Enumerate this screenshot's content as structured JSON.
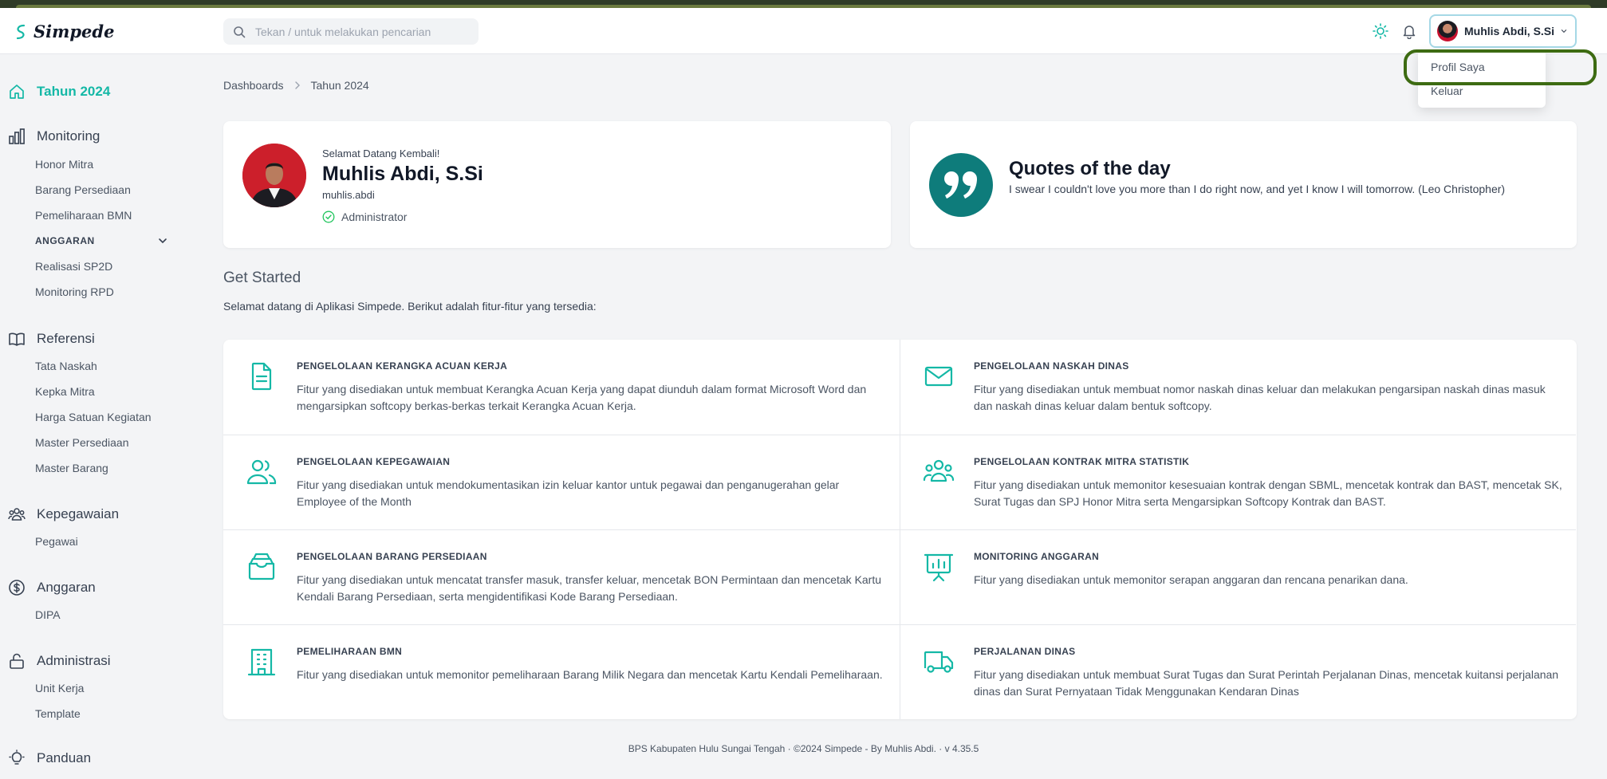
{
  "app": {
    "name": "Simpede"
  },
  "search": {
    "placeholder": "Tekan / untuk melakukan pencarian"
  },
  "user": {
    "name": "Muhlis Abdi, S.Si",
    "username": "muhlis.abdi",
    "role": "Administrator"
  },
  "user_menu": {
    "items": [
      "Profil Saya",
      "Keluar"
    ]
  },
  "sidebar": {
    "home": "Tahun 2024",
    "monitoring": {
      "label": "Monitoring",
      "items": [
        "Honor Mitra",
        "Barang Persediaan",
        "Pemeliharaan BMN"
      ],
      "section": "ANGGARAN",
      "section_items": [
        "Realisasi SP2D",
        "Monitoring RPD"
      ]
    },
    "referensi": {
      "label": "Referensi",
      "items": [
        "Tata Naskah",
        "Kepka Mitra",
        "Harga Satuan Kegiatan",
        "Master Persediaan",
        "Master Barang"
      ]
    },
    "kepegawaian": {
      "label": "Kepegawaian",
      "items": [
        "Pegawai"
      ]
    },
    "anggaran": {
      "label": "Anggaran",
      "items": [
        "DIPA"
      ]
    },
    "administrasi": {
      "label": "Administrasi",
      "items": [
        "Unit Kerja",
        "Template"
      ]
    },
    "panduan": {
      "label": "Panduan"
    }
  },
  "breadcrumb": [
    "Dashboards",
    "Tahun 2024"
  ],
  "welcome": {
    "greeting": "Selamat Datang Kembali!"
  },
  "quote": {
    "title": "Quotes of the day",
    "text": "I swear I couldn't love you more than I do right now, and yet I know I will tomorrow. (Leo Christopher)"
  },
  "get_started": {
    "title": "Get Started",
    "description": "Selamat datang di Aplikasi Simpede. Berikut adalah fitur-fitur yang tersedia:"
  },
  "features": [
    {
      "title": "PENGELOLAAN KERANGKA ACUAN KERJA",
      "desc": "Fitur yang disediakan untuk membuat Kerangka Acuan Kerja yang dapat diunduh dalam format Microsoft Word dan mengarsipkan softcopy berkas-berkas terkait Kerangka Acuan Kerja.",
      "icon": "document-icon"
    },
    {
      "title": "PENGELOLAAN NASKAH DINAS",
      "desc": "Fitur yang disediakan untuk membuat nomor naskah dinas keluar dan melakukan pengarsipan naskah dinas masuk dan naskah dinas keluar dalam bentuk softcopy.",
      "icon": "mail-icon"
    },
    {
      "title": "PENGELOLAAN KEPEGAWAIAN",
      "desc": "Fitur yang disediakan untuk mendokumentasikan izin keluar kantor untuk pegawai dan penganugerahan gelar Employee of the Month",
      "icon": "users-icon"
    },
    {
      "title": "PENGELOLAAN KONTRAK MITRA STATISTIK",
      "desc": "Fitur yang disediakan untuk memonitor kesesuaian kontrak dengan SBML, mencetak kontrak dan BAST, mencetak SK, Surat Tugas dan SPJ Honor Mitra serta Mengarsipkan Softcopy Kontrak dan BAST.",
      "icon": "user-group-icon"
    },
    {
      "title": "PENGELOLAAN BARANG PERSEDIAAN",
      "desc": "Fitur yang disediakan untuk mencatat transfer masuk, transfer keluar, mencetak BON Permintaan dan mencetak Kartu Kendali Barang Persediaan, serta mengidentifikasi Kode Barang Persediaan.",
      "icon": "inbox-stack-icon"
    },
    {
      "title": "MONITORING ANGGARAN",
      "desc": "Fitur yang disediakan untuk memonitor serapan anggaran dan rencana penarikan dana.",
      "icon": "presentation-chart-icon"
    },
    {
      "title": "PEMELIHARAAN BMN",
      "desc": "Fitur yang disediakan untuk memonitor pemeliharaan Barang Milik Negara dan mencetak Kartu Kendali Pemeliharaan.",
      "icon": "building-icon"
    },
    {
      "title": "PERJALANAN DINAS",
      "desc": "Fitur yang disediakan untuk membuat Surat Tugas dan Surat Perintah Perjalanan Dinas, mencetak kuitansi perjalanan dinas dan Surat Pernyataan Tidak Menggunakan Kendaran Dinas",
      "icon": "truck-icon"
    }
  ],
  "footer": {
    "org": "BPS Kabupaten Hulu Sungai Tengah",
    "copyright": "©2024 Simpede - By Muhlis Abdi.",
    "version": "v 4.35.5"
  },
  "colors": {
    "accent": "#14b8a6",
    "quote_circle": "#0e7c7b",
    "highlight_ring": "#3d6b12"
  }
}
